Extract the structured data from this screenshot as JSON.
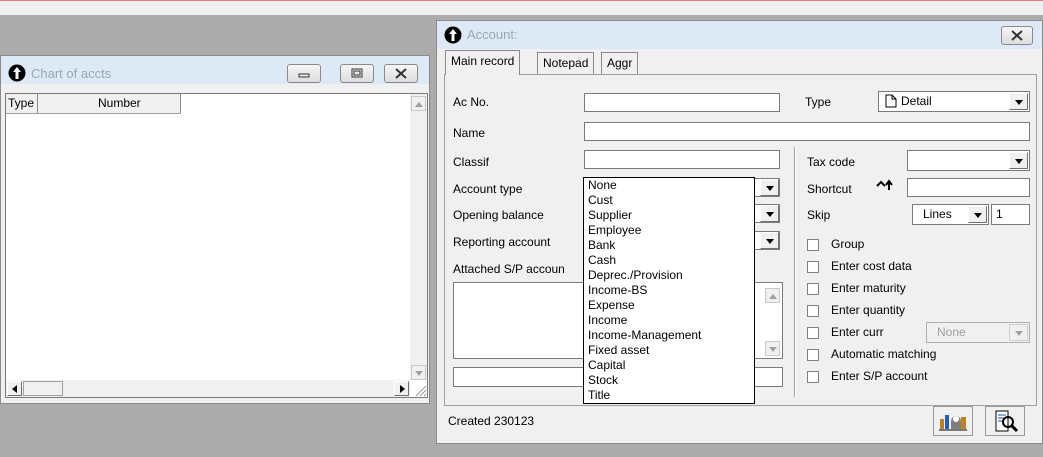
{
  "chart_window": {
    "title": "Chart of accts",
    "columns": [
      "Type",
      "Number"
    ]
  },
  "account_window": {
    "title": "Account:",
    "tabs": [
      "Main record",
      "Notepad",
      "Aggr"
    ],
    "labels": {
      "ac_no": "Ac No.",
      "name": "Name",
      "classif": "Classif",
      "account_type": "Account type",
      "opening_balance": "Opening balance",
      "reporting_account": "Reporting account",
      "attached_sp": "Attached S/P accoun",
      "type": "Type",
      "tax_code": "Tax code",
      "shortcut": "Shortcut",
      "skip": "Skip"
    },
    "values": {
      "ac_no": "",
      "name": "",
      "classif": "",
      "account_type": "None",
      "type": "Detail",
      "tax_code": "",
      "shortcut": "",
      "skip_unit": "Lines",
      "skip_count": "1",
      "enter_curr": "None"
    },
    "account_type_options": [
      "None",
      "Cust",
      "Supplier",
      "Employee",
      "Bank",
      "Cash",
      "Deprec./Provision",
      "Income-BS",
      "Expense",
      "Income",
      "Income-Management",
      "Fixed asset",
      "Capital",
      "Stock",
      "Title"
    ],
    "checkboxes": [
      {
        "label": "Group",
        "checked": false
      },
      {
        "label": "Enter cost data",
        "checked": false
      },
      {
        "label": "Enter maturity",
        "checked": false
      },
      {
        "label": "Enter quantity",
        "checked": false
      },
      {
        "label": "Enter curr",
        "checked": false
      },
      {
        "label": "Automatic matching",
        "checked": false
      },
      {
        "label": "Enter S/P account",
        "checked": false
      }
    ],
    "created": "Created 230123"
  },
  "icons": {
    "app": "info-arrow-icon",
    "shortcut": "shortcut-arrow-icon",
    "report": "report-icon",
    "search": "magnify-document-icon"
  }
}
